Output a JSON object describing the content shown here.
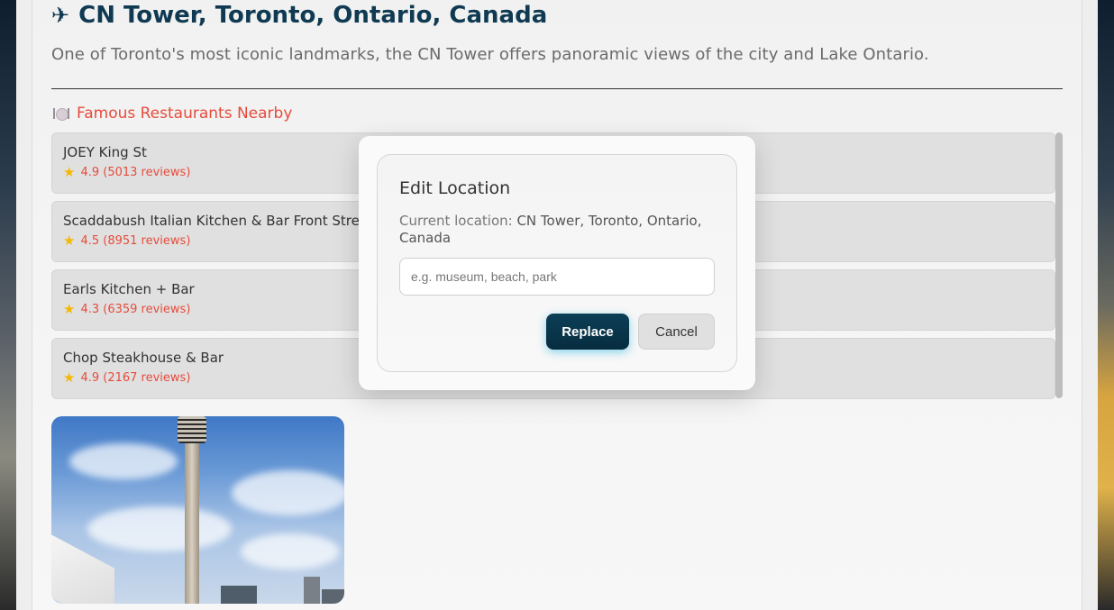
{
  "place": {
    "title": "CN Tower, Toronto, Ontario, Canada",
    "description": "One of Toronto's most iconic landmarks, the CN Tower offers panoramic views of the city and Lake Ontario."
  },
  "restaurants_section": {
    "heading": "Famous Restaurants Nearby",
    "items": [
      {
        "name": "JOEY King St",
        "rating": "4.9 (5013 reviews)"
      },
      {
        "name": "Scaddabush Italian Kitchen & Bar Front Street",
        "rating": "4.5 (8951 reviews)"
      },
      {
        "name": "Earls Kitchen + Bar",
        "rating": "4.3 (6359 reviews)"
      },
      {
        "name": "Chop Steakhouse & Bar",
        "rating": "4.9 (2167 reviews)"
      }
    ]
  },
  "modal": {
    "title": "Edit Location",
    "current_label": "Current location:",
    "current_value": "CN Tower, Toronto, Ontario, Canada",
    "input_value": "",
    "input_placeholder": "e.g. museum, beach, park",
    "replace_label": "Replace",
    "cancel_label": "Cancel"
  },
  "icons": {
    "title_icon": "airplane-icon",
    "section_icon": "plate-icon",
    "rating_icon": "star-icon"
  },
  "colors": {
    "title": "#0f3a52",
    "section_heading": "#e64c3c",
    "rating_text": "#e64c3c",
    "star": "#f5b800",
    "replace_button": "#0c3f56"
  }
}
